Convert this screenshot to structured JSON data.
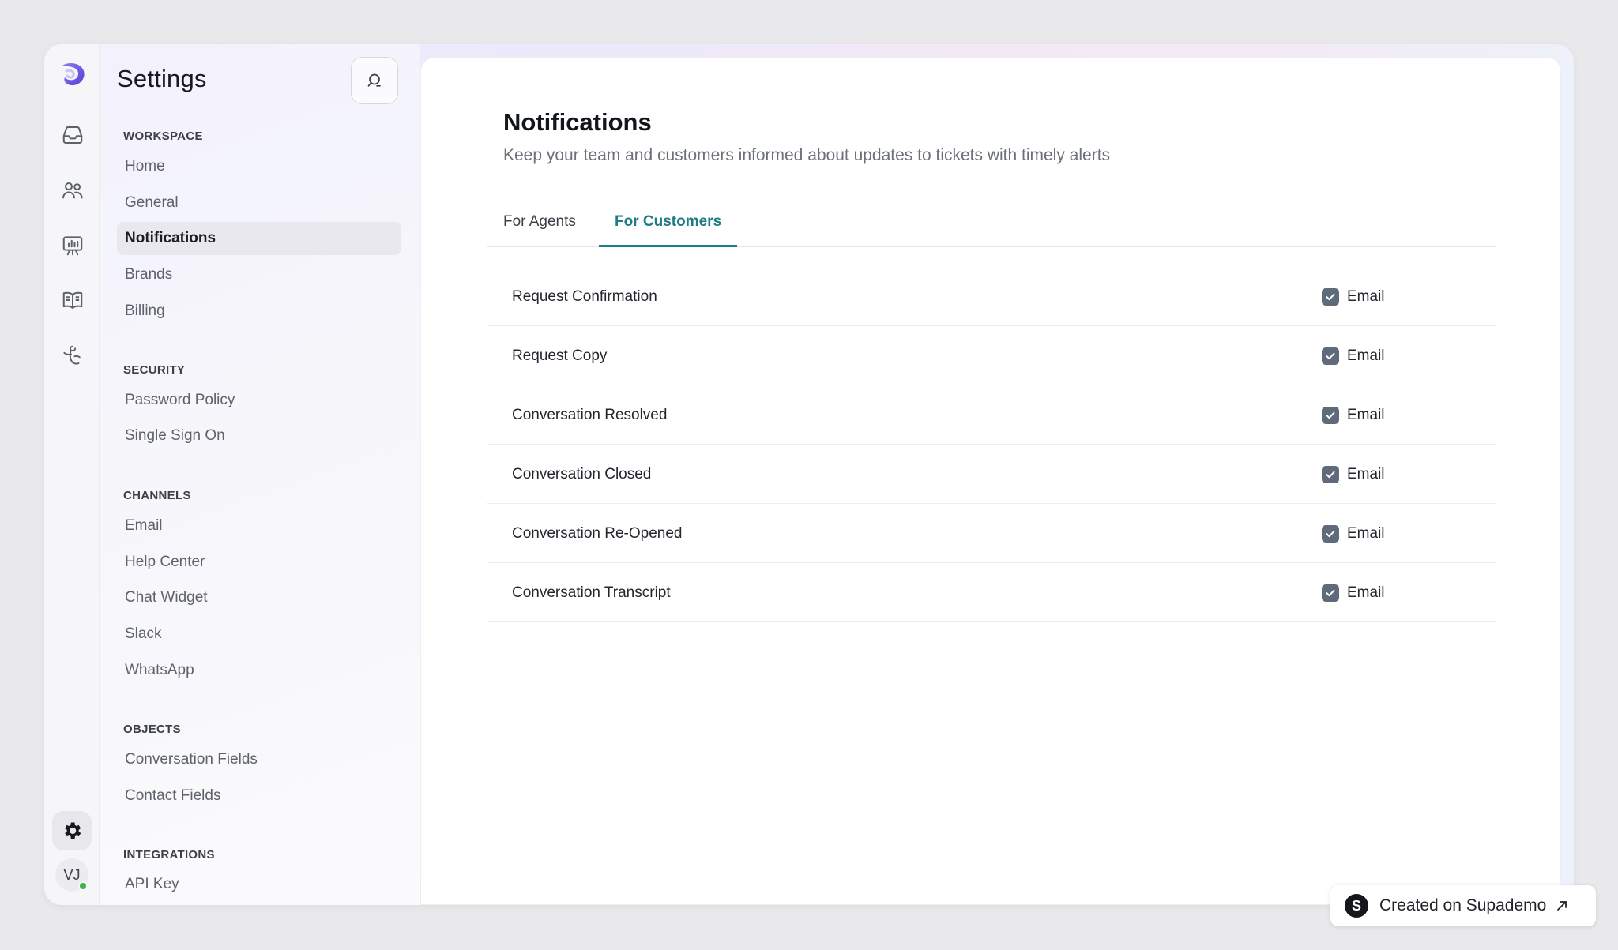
{
  "settings": {
    "title": "Settings",
    "sections": [
      {
        "heading": "WORKSPACE",
        "items": [
          "Home",
          "General",
          "Notifications",
          "Brands",
          "Billing"
        ]
      },
      {
        "heading": "SECURITY",
        "items": [
          "Password Policy",
          "Single Sign On"
        ]
      },
      {
        "heading": "CHANNELS",
        "items": [
          "Email",
          "Help Center",
          "Chat Widget",
          "Slack",
          "WhatsApp"
        ]
      },
      {
        "heading": "OBJECTS",
        "items": [
          "Conversation Fields",
          "Contact Fields"
        ]
      },
      {
        "heading": "INTEGRATIONS",
        "items": [
          "API Key"
        ]
      }
    ],
    "active_item": "Notifications"
  },
  "rail": {
    "icons": [
      "logo-icon",
      "inbox-icon",
      "users-icon",
      "reports-icon",
      "knowledge-base-icon",
      "automation-icon"
    ],
    "settings_icon": "gear-icon",
    "avatar_initials": "VJ",
    "presence_color": "#3fb34f"
  },
  "main": {
    "heading": "Notifications",
    "subheading": "Keep your team and customers informed about updates to tickets with timely alerts",
    "tabs": [
      {
        "label": "For Agents",
        "active": false
      },
      {
        "label": "For Customers",
        "active": true
      }
    ],
    "rows": [
      {
        "label": "Request Confirmation",
        "channel": "Email",
        "checked": true
      },
      {
        "label": "Request Copy",
        "channel": "Email",
        "checked": true
      },
      {
        "label": "Conversation Resolved",
        "channel": "Email",
        "checked": true
      },
      {
        "label": "Conversation Closed",
        "channel": "Email",
        "checked": true
      },
      {
        "label": "Conversation Re-Opened",
        "channel": "Email",
        "checked": true
      },
      {
        "label": "Conversation Transcript",
        "channel": "Email",
        "checked": true
      }
    ]
  },
  "badge": {
    "logo_letter": "S",
    "text": "Created on Supademo"
  },
  "colors": {
    "accent": "#1e7c85",
    "checkbox": "#5f6b7a",
    "logo": "#6a5ae0"
  }
}
